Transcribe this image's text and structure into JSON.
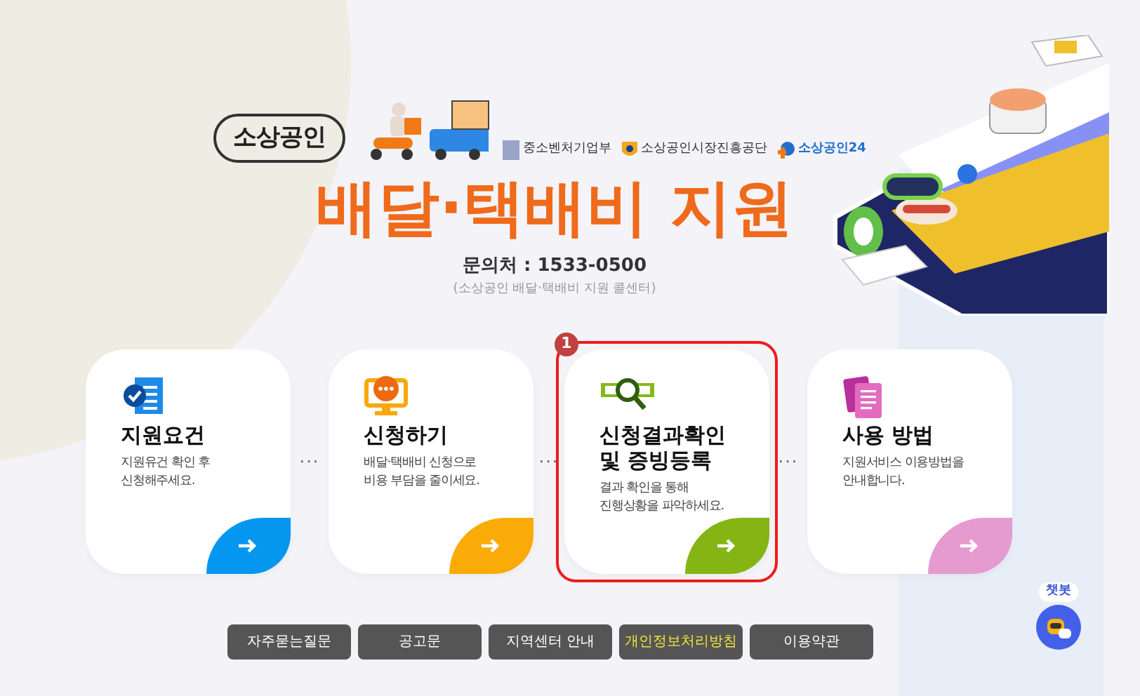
{
  "header": {
    "brand": "소상공인",
    "agencies": [
      {
        "name": "중소벤처기업부"
      },
      {
        "name": "소상공인시장진흥공단"
      },
      {
        "name": "소상공인24"
      }
    ],
    "title": "배달·택배비 지원",
    "contact": "문의처 : 1533-0500",
    "contact_note": "(소상공인 배달·택배비 지원 콜센터)"
  },
  "cards": [
    {
      "kind": "document",
      "title": "지원요건",
      "text": "지원유건 확인 후\n신청해주세요.",
      "color": "#0596f0",
      "highlighted": false
    },
    {
      "kind": "monitor",
      "title": "신청하기",
      "text": "배달·택배비 신청으로\n비용 부담을 줄이세요.",
      "color": "#fbab08",
      "highlighted": false
    },
    {
      "kind": "search",
      "title": "신청결과확인\n및 증빙등록",
      "text": "결과 확인을 통해\n진행상황을 파악하세요.",
      "color": "#84b515",
      "highlighted": true,
      "badge": "1"
    },
    {
      "kind": "pages",
      "title": "사용 방법",
      "text": "지원서비스 이용방법을\n안내합니다.",
      "color": "#e59ad0",
      "highlighted": false
    }
  ],
  "separators": [
    "···",
    "···",
    "···"
  ],
  "buttons": [
    {
      "label": "자주묻는질문",
      "emphasis": false
    },
    {
      "label": "공고문",
      "emphasis": false
    },
    {
      "label": "지역센터 안내",
      "emphasis": false
    },
    {
      "label": "개인정보처리방침",
      "emphasis": true
    },
    {
      "label": "이용약관",
      "emphasis": false
    }
  ],
  "chatbot": {
    "label": "챗봇"
  }
}
